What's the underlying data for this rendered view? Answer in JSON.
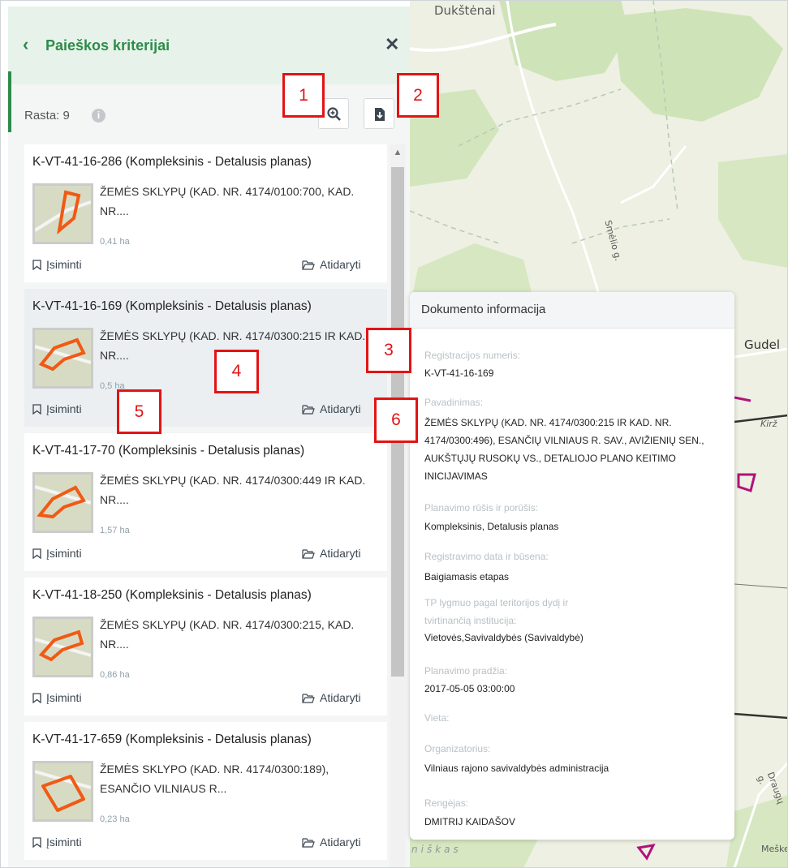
{
  "panel": {
    "back_icon": "chevron-left-icon",
    "title": "Paieškos kriterijai",
    "close_icon": "close-icon",
    "found_label": "Rasta: 9",
    "info_icon": "info-icon",
    "zoom_icon": "zoom-in-icon",
    "export_icon": "file-download-icon",
    "accent_color": "#2e8b4a"
  },
  "markers": [
    "1",
    "2",
    "3",
    "4",
    "5",
    "6"
  ],
  "results": [
    {
      "title": "K-VT-41-16-286 (Kompleksinis - Detalusis planas)",
      "desc": "ŽEMĖS SKLYPŲ (KAD. NR. 4174/0100:700, KAD. NR....",
      "area": "0,41 ha",
      "remember": "Įsiminti",
      "open": "Atidaryti"
    },
    {
      "title": "K-VT-41-16-169 (Kompleksinis - Detalusis planas)",
      "desc": "ŽEMĖS SKLYPŲ (KAD. NR. 4174/0300:215 IR KAD. NR....",
      "area": "0,5 ha",
      "remember": "Įsiminti",
      "open": "Atidaryti"
    },
    {
      "title": "K-VT-41-17-70 (Kompleksinis - Detalusis planas)",
      "desc": "ŽEMĖS SKLYPŲ (KAD. NR. 4174/0300:449 IR KAD. NR....",
      "area": "1,57 ha",
      "remember": "Įsiminti",
      "open": "Atidaryti"
    },
    {
      "title": "K-VT-41-18-250 (Kompleksinis - Detalusis planas)",
      "desc": "ŽEMĖS SKLYPŲ (KAD. NR. 4174/0300:215, KAD. NR....",
      "area": "0,86 ha",
      "remember": "Įsiminti",
      "open": "Atidaryti"
    },
    {
      "title": "K-VT-41-17-659 (Kompleksinis - Detalusis planas)",
      "desc": "ŽEMĖS SKLYPO (KAD. NR. 4174/0300:189), ESANČIO VILNIAUS R...",
      "area": "0,23 ha",
      "remember": "Įsiminti",
      "open": "Atidaryti"
    }
  ],
  "popup": {
    "title": "Dokumento informacija",
    "fields": [
      {
        "label": "Registracijos numeris:",
        "value": "K-VT-41-16-169"
      },
      {
        "label": "Pavadinimas:",
        "value": "ŽEMĖS SKLYPŲ (KAD. NR. 4174/0300:215 IR KAD. NR. 4174/0300:496), ESANČIŲ VILNIAUS R. SAV., AVIŽIENIŲ SEN., AUKŠTŲJŲ RUSOKŲ VS., DETALIOJO PLANO KEITIMO INICIJAVIMAS"
      },
      {
        "label": "Planavimo rūšis ir porūšis:",
        "value": "Kompleksinis, Detalusis planas"
      },
      {
        "label": "Registravimo data ir būsena:",
        "value": "Baigiamasis etapas"
      },
      {
        "label": "TP lygmuo pagal teritorijos dydį ir tvirtinančią institucija:",
        "value": "Vietovės,Savivaldybės (Savivaldybė)"
      },
      {
        "label": "Planavimo pradžia:",
        "value": "2017-05-05 03:00:00"
      },
      {
        "label": "Vieta:",
        "value": ""
      },
      {
        "label": "Organizatorius:",
        "value": "Vilniaus rajono savivaldybės administracija"
      },
      {
        "label": "Rengėjas:",
        "value": "DMITRIJ KAIDAŠOV"
      }
    ]
  },
  "map": {
    "labels": [
      "Dukštėnai",
      "Smėlio g.",
      "Gudel",
      "Kirž",
      "Draugų g.",
      "Meške",
      "niškas"
    ]
  }
}
